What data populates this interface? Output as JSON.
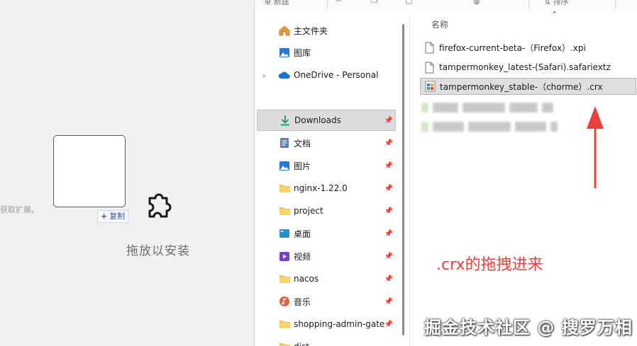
{
  "browser": {
    "hint_text": "获取扩展。",
    "copy_label": "复制",
    "drop_label": "拖放以安装"
  },
  "explorer": {
    "toolbar": {
      "new_label": "新建",
      "sort_label": "排序"
    },
    "nav_items": [
      {
        "label": "主文件夹",
        "icon": "home-icon",
        "pinned": false,
        "expandable": false
      },
      {
        "label": "图库",
        "icon": "gallery-icon",
        "pinned": false,
        "expandable": false
      },
      {
        "label": "OneDrive - Personal",
        "icon": "onedrive-icon",
        "pinned": false,
        "expandable": true
      },
      {
        "label": "Downloads",
        "icon": "download-icon",
        "pinned": true,
        "selected": true
      },
      {
        "label": "文档",
        "icon": "document-icon",
        "pinned": true
      },
      {
        "label": "图片",
        "icon": "picture-icon",
        "pinned": true
      },
      {
        "label": "nginx-1.22.0",
        "icon": "folder-icon",
        "pinned": true
      },
      {
        "label": "project",
        "icon": "folder-icon",
        "pinned": true
      },
      {
        "label": "桌面",
        "icon": "desktop-icon",
        "pinned": true
      },
      {
        "label": "视频",
        "icon": "video-icon",
        "pinned": true
      },
      {
        "label": "nacos",
        "icon": "folder-icon",
        "pinned": true
      },
      {
        "label": "音乐",
        "icon": "music-icon",
        "pinned": true
      },
      {
        "label": "shopping-admin-gate",
        "icon": "folder-icon",
        "pinned": true
      },
      {
        "label": "dist",
        "icon": "folder-icon",
        "pinned": true
      }
    ],
    "column_header": "名称",
    "files": [
      {
        "name": "firefox-current-beta-（Firefox）.xpi",
        "icon": "file-icon"
      },
      {
        "name": "tampermonkey_latest-(Safari).safariextz",
        "icon": "file-icon"
      },
      {
        "name": "tampermonkey_stable-（chorme）.crx",
        "icon": "crx-file-icon",
        "selected": true
      }
    ]
  },
  "annotation_text": ".crx的拖拽进来",
  "watermark_text": "掘金技术社区 @ 搜罗万相",
  "colors": {
    "annotation": "#e8403a",
    "selection": "#dedede",
    "folder": "#f4c44e"
  }
}
